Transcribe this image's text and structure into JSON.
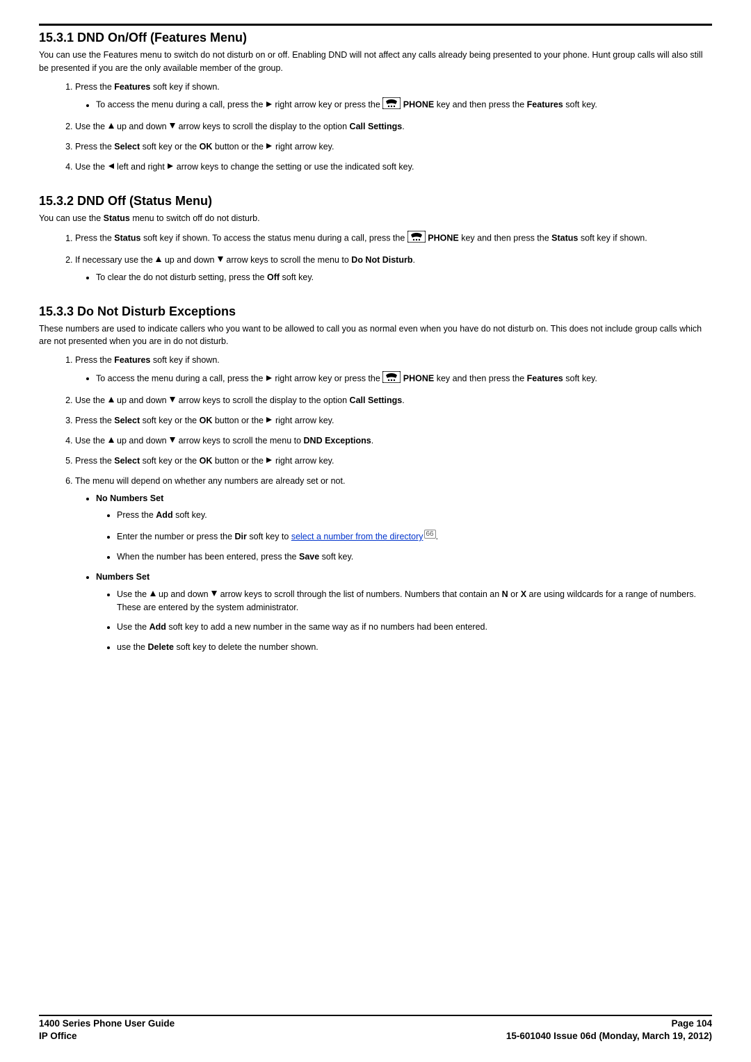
{
  "section1": {
    "heading": "15.3.1 DND On/Off (Features Menu)",
    "intro": "You can use the Features menu to switch do not disturb on or off. Enabling DND will not affect any calls already being presented to your phone. Hunt group calls will also still be presented if you are the only available member of the group.",
    "step1_a": "Press the ",
    "step1_b": "Features",
    "step1_c": " soft key if shown.",
    "sub_a": "To access the menu during a call, press the ",
    "sub_b": " right arrow key or press the ",
    "sub_c": " PHONE",
    "sub_d": " key and then press the ",
    "sub_e": "Features",
    "sub_f": " soft key.",
    "step2_a": "Use the ",
    "step2_b": " up and down ",
    "step2_c": " arrow keys to scroll the display to the option ",
    "step2_d": "Call Settings",
    "step2_e": ".",
    "step3_a": "Press the ",
    "step3_b": "Select",
    "step3_c": " soft key or the ",
    "step3_d": "OK",
    "step3_e": " button or the ",
    "step3_f": " right arrow key.",
    "step4_a": "Use the ",
    "step4_b": " left and right ",
    "step4_c": " arrow keys to change the setting or use the indicated soft key."
  },
  "section2": {
    "heading": "15.3.2 DND Off (Status Menu)",
    "intro_a": "You can use the ",
    "intro_b": "Status",
    "intro_c": " menu to switch off do not disturb.",
    "step1_a": "Press the ",
    "step1_b": "Status",
    "step1_c": " soft key if shown. To access the status menu during a call, press the ",
    "step1_d": " PHONE",
    "step1_e": " key and then press the ",
    "step1_f": "Status",
    "step1_g": " soft key if shown.",
    "step2_a": "If necessary use the ",
    "step2_b": " up and down ",
    "step2_c": " arrow keys to scroll the menu to ",
    "step2_d": "Do Not Disturb",
    "step2_e": ".",
    "sub_a": "To clear the do not disturb setting, press the ",
    "sub_b": "Off",
    "sub_c": " soft key."
  },
  "section3": {
    "heading": "15.3.3 Do Not Disturb Exceptions",
    "intro": "These numbers are used to indicate callers who you want to be allowed to call you as normal even when you have do not disturb on. This does not include group calls which are not presented when you are in do not disturb.",
    "step1_a": "Press the ",
    "step1_b": "Features",
    "step1_c": " soft key if shown.",
    "sub_a": "To access the menu during a call, press the ",
    "sub_b": " right arrow key or press the ",
    "sub_c": " PHONE",
    "sub_d": " key and then press the ",
    "sub_e": "Features",
    "sub_f": " soft key.",
    "step2_a": "Use the ",
    "step2_b": " up and down ",
    "step2_c": " arrow keys to scroll the display to the option ",
    "step2_d": "Call Settings",
    "step2_e": ".",
    "step3_a": "Press the ",
    "step3_b": "Select",
    "step3_c": " soft key or the ",
    "step3_d": "OK",
    "step3_e": " button or the ",
    "step3_f": " right arrow key.",
    "step4_a": "Use the ",
    "step4_b": " up and down ",
    "step4_c": " arrow keys to scroll the menu to ",
    "step4_d": "DND Exceptions",
    "step4_e": ".",
    "step5_a": "Press the ",
    "step5_b": "Select",
    "step5_c": " soft key or the ",
    "step5_d": "OK",
    "step5_e": " button or the ",
    "step5_f": " right arrow key.",
    "step6": "The menu will depend on whether any numbers are already set or not.",
    "nns_label": "No Numbers Set",
    "nns1_a": "Press the ",
    "nns1_b": "Add",
    "nns1_c": " soft key.",
    "nns2_a": "Enter the number or press the ",
    "nns2_b": "Dir",
    "nns2_c": " soft key to ",
    "nns2_link": "select a number from the directory",
    "nns2_ref": "66",
    "nns2_d": ".",
    "nns3_a": "When the number has been entered, press the ",
    "nns3_b": "Save",
    "nns3_c": " soft key.",
    "ns_label": "Numbers Set",
    "ns1_a": "Use the ",
    "ns1_b": " up and down ",
    "ns1_c": " arrow keys to scroll through the list of numbers. Numbers that contain an ",
    "ns1_d": "N",
    "ns1_e": " or ",
    "ns1_f": "X",
    "ns1_g": " are using wildcards for a range of numbers. These are entered by the system administrator.",
    "ns2_a": "Use the ",
    "ns2_b": "Add",
    "ns2_c": " soft key to add a new number in the same way as if no numbers had been entered.",
    "ns3_a": "use the ",
    "ns3_b": "Delete",
    "ns3_c": " soft key to delete the number shown."
  },
  "footer": {
    "left1": "1400 Series Phone User Guide",
    "left2": "IP Office",
    "right1": "Page 104",
    "right2": "15-601040 Issue 06d (Monday, March 19, 2012)"
  }
}
